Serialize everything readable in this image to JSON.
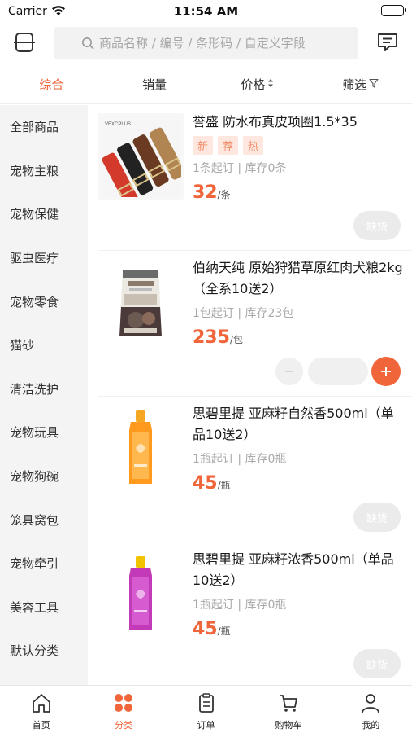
{
  "status_bar": {
    "carrier": "Carrier",
    "time": "11:54 AM"
  },
  "header": {
    "search_placeholder": "商品名称 / 编号 / 条形码 / 自定义字段"
  },
  "sort_bar": {
    "items": [
      {
        "label": "综合",
        "active": true
      },
      {
        "label": "销量"
      },
      {
        "label": "价格",
        "icon": "sort-arrows-icon"
      },
      {
        "label": "筛选",
        "icon": "filter-icon"
      }
    ]
  },
  "sidebar": {
    "items": [
      {
        "label": "全部商品"
      },
      {
        "label": "宠物主粮"
      },
      {
        "label": "宠物保健"
      },
      {
        "label": "驱虫医疗"
      },
      {
        "label": "宠物零食"
      },
      {
        "label": "猫砂"
      },
      {
        "label": "清洁洗护"
      },
      {
        "label": "宠物玩具"
      },
      {
        "label": "宠物狗碗"
      },
      {
        "label": "笼具窝包"
      },
      {
        "label": "宠物牵引"
      },
      {
        "label": "美容工具"
      },
      {
        "label": "默认分类"
      }
    ]
  },
  "products": [
    {
      "name": "誉盛 防水布真皮项圈1.5*35",
      "tags": [
        "新",
        "荐",
        "热"
      ],
      "meta": "1条起订 | 库存0条",
      "price": "32",
      "unit": "/条",
      "action": "缺货",
      "image": "collar-image"
    },
    {
      "name": "伯纳天纯 原始狩猎草原红肉犬粮2kg（全系10送2）",
      "meta": "1包起订 | 库存23包",
      "price": "235",
      "unit": "/包",
      "image": "dog-food-bag-image"
    },
    {
      "name": "思碧里提 亚麻籽自然香500ml（单品10送2）",
      "meta": "1瓶起订 | 库存0瓶",
      "price": "45",
      "unit": "/瓶",
      "action": "缺货",
      "image": "orange-shampoo-bottle-image"
    },
    {
      "name": "思碧里提 亚麻籽浓香500ml（单品10送2）",
      "meta": "1瓶起订 | 库存0瓶",
      "price": "45",
      "unit": "/瓶",
      "action": "缺货",
      "image": "pink-shampoo-bottle-image"
    }
  ],
  "tab_bar": {
    "items": [
      {
        "label": "首页",
        "icon": "home-icon"
      },
      {
        "label": "分类",
        "icon": "category-icon",
        "active": true
      },
      {
        "label": "订单",
        "icon": "order-icon"
      },
      {
        "label": "购物车",
        "icon": "cart-icon"
      },
      {
        "label": "我的",
        "icon": "profile-icon"
      }
    ]
  },
  "colors": {
    "accent": "#f0653a",
    "sidebar_bg": "#f4f4f4",
    "tag_bg": "#fde7df"
  }
}
